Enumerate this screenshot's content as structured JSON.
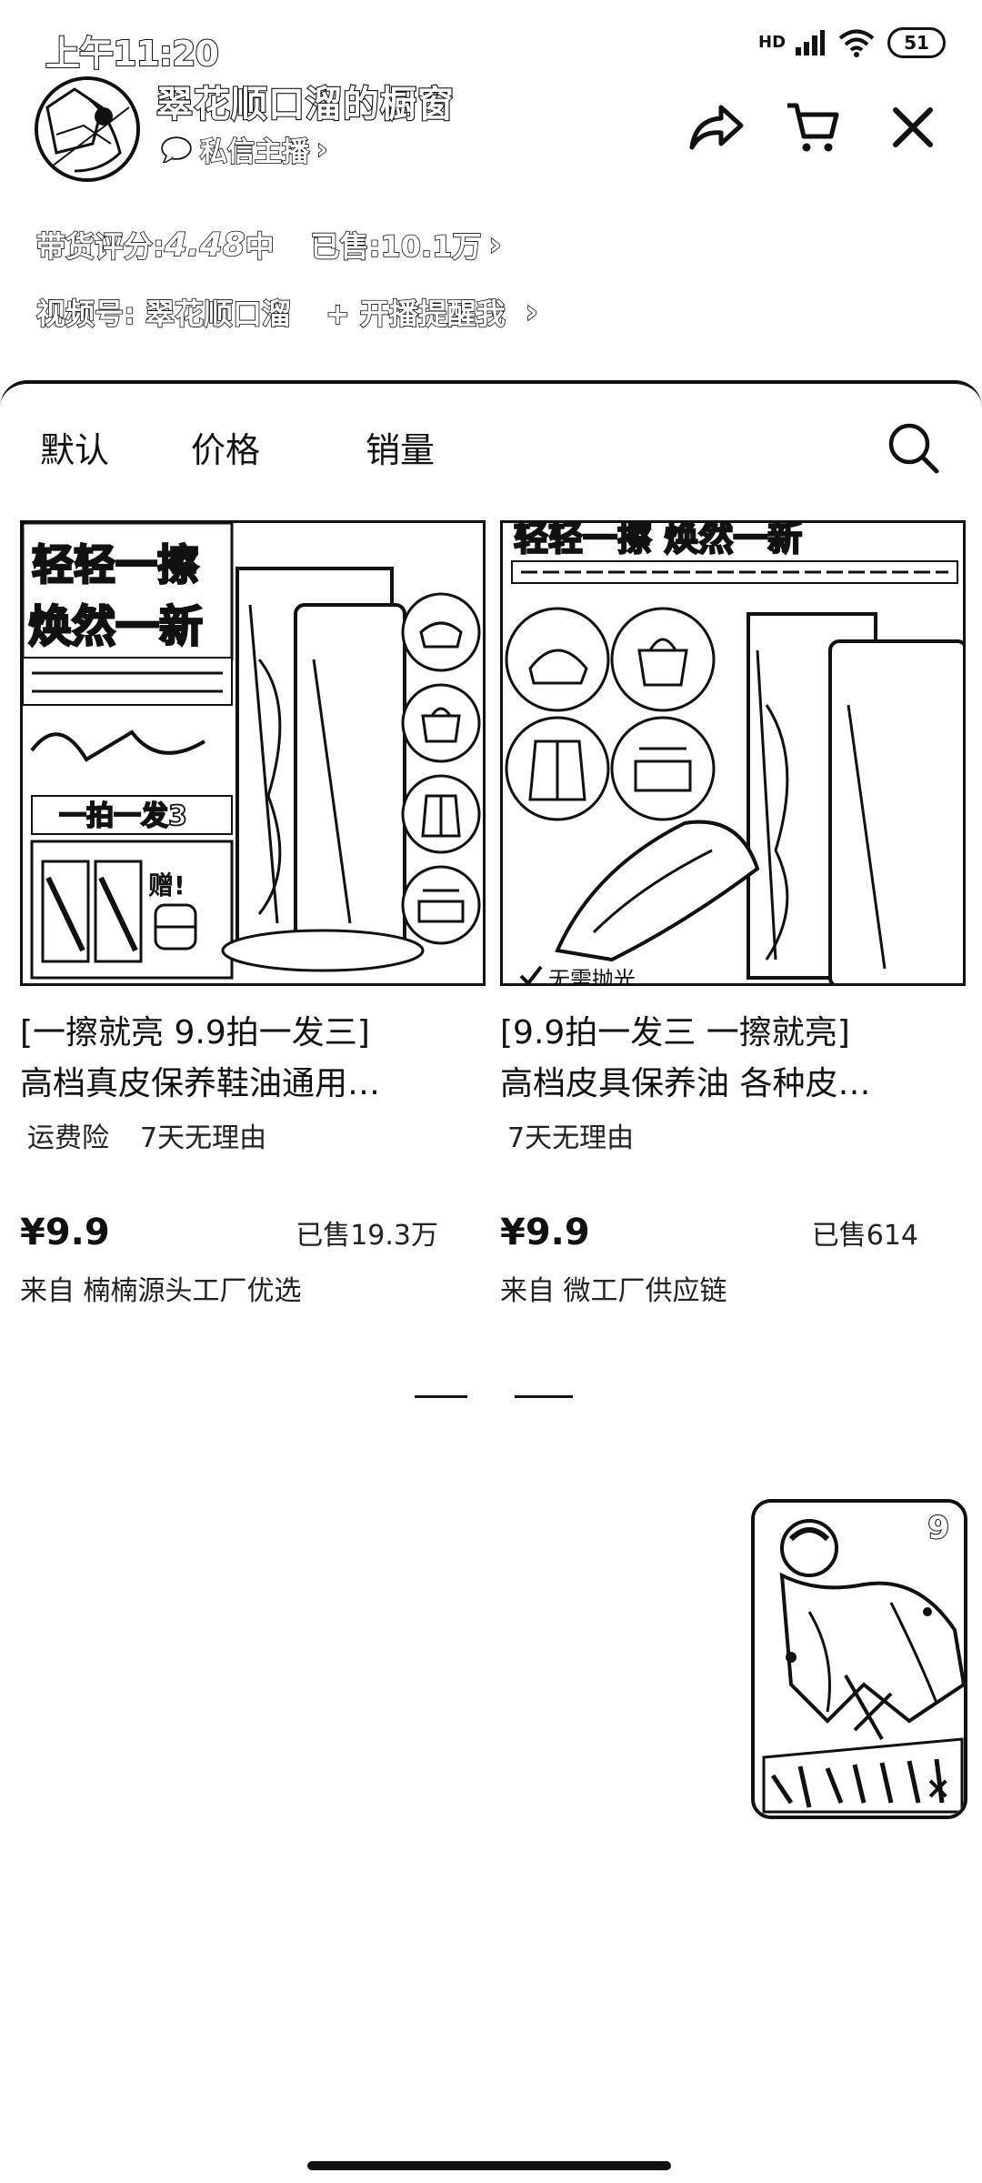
{
  "status_bar": {
    "time": "上午11:20",
    "signal_label": "HD",
    "battery": "51"
  },
  "header": {
    "shop_title": "翠花顺口溜的橱窗",
    "message_label": "私信主播",
    "message_chevron": "›"
  },
  "stats": {
    "rating_label": "带货评分: ",
    "rating_value": "4.48",
    "rating_level": "中",
    "sold_label": "已售: ",
    "sold_value": "10.1万",
    "chevron": "›",
    "video_label": "视频号: 翠花顺口溜",
    "remind_label": "+ 开播提醒我",
    "remind_chevron": "›"
  },
  "sort_tabs": [
    "默认",
    "价格",
    "销量"
  ],
  "products": [
    {
      "image_headline_1": "轻轻一擦",
      "image_headline_2": "焕然一新",
      "image_badge": "一拍一发3",
      "image_gift": "赠!",
      "title": "[一擦就亮 9.9拍一发三]",
      "subtitle": "高档真皮保养鞋油通用…",
      "tags": [
        "运费险",
        "7天无理由"
      ],
      "price": "¥9.9",
      "sold": "已售19.3万",
      "source": "来自 楠楠源头工厂优选"
    },
    {
      "image_headline_1": "轻轻一擦 焕然一新",
      "image_badge": "无需抛光",
      "title": "[9.9拍一发三  一擦就亮]",
      "subtitle": "高档皮具保养油 各种皮…",
      "tags": [
        "7天无理由"
      ],
      "price": "¥9.9",
      "sold": "已售614",
      "source": "来自 微工厂供应链"
    }
  ],
  "floating_live": {
    "badge": "9",
    "close": "×"
  }
}
